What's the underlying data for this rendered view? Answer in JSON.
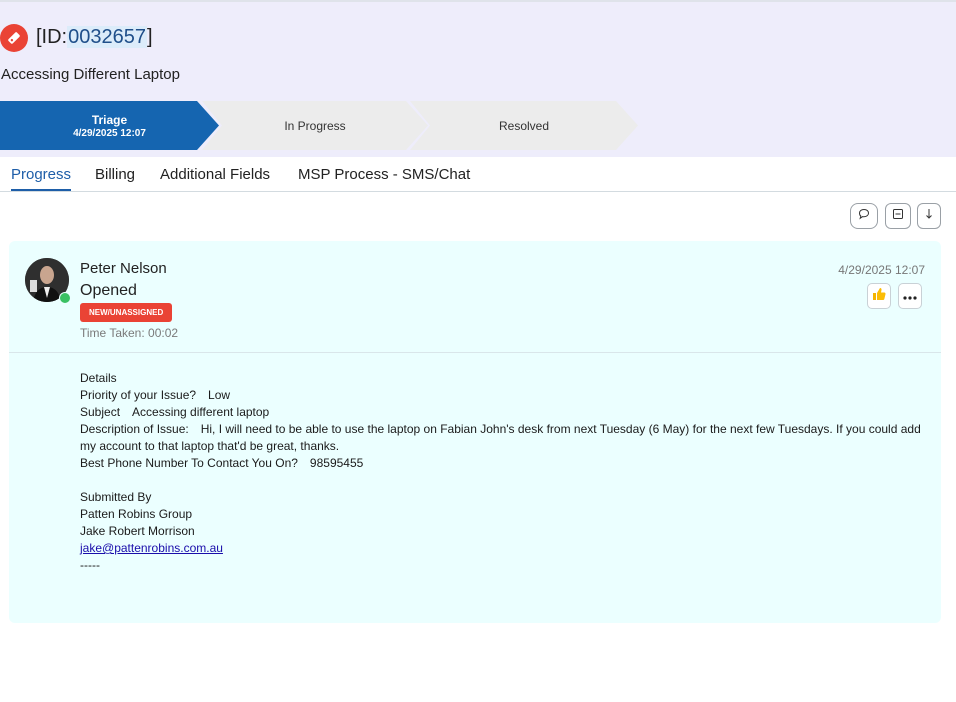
{
  "ticket": {
    "id_prefix": "[ID:",
    "id_number": "0032657",
    "id_suffix": "]",
    "title": "Accessing Different Laptop"
  },
  "stages": [
    {
      "label": "Triage",
      "date": "4/29/2025 12:07",
      "active": true
    },
    {
      "label": "In Progress",
      "active": false
    },
    {
      "label": "Resolved",
      "active": false
    }
  ],
  "tabs": [
    "Progress",
    "Billing",
    "Additional Fields",
    "MSP Process - SMS/Chat"
  ],
  "active_tab": "Progress",
  "toolbar_icons": [
    "comment-icon",
    "collapse-icon",
    "sort-down-icon"
  ],
  "entry": {
    "author": "Peter Nelson",
    "action": "Opened",
    "status_badge": "NEW/UNASSIGNED",
    "time_taken": "Time Taken: 00:02",
    "timestamp": "4/29/2025 12:07",
    "details": {
      "heading": "Details",
      "priority_label": "Priority of your Issue?",
      "priority_value": "Low",
      "subject_label": "Subject",
      "subject_value": "Accessing different laptop",
      "description_label": "Description of Issue:",
      "description_value": "Hi, I will need to be able to use the laptop on Fabian John's desk from next Tuesday (6 May) for the next few Tuesdays. If you could add my account to that laptop that'd be great, thanks.",
      "phone_label": "Best Phone Number To Contact You On?",
      "phone_value": "98595455",
      "submitted_by": "Submitted By",
      "company": "Patten Robins Group",
      "submitter": "Jake Robert Morrison",
      "email": "jake@pattenrobins.com.au",
      "separator": "-----"
    }
  },
  "colors": {
    "header_bg": "#eeedfb",
    "active_stage": "#1565b0",
    "inactive_stage": "#ececec",
    "badge": "#ea4335",
    "card_bg": "#ebffff",
    "active_tab": "#1e5ea8"
  }
}
